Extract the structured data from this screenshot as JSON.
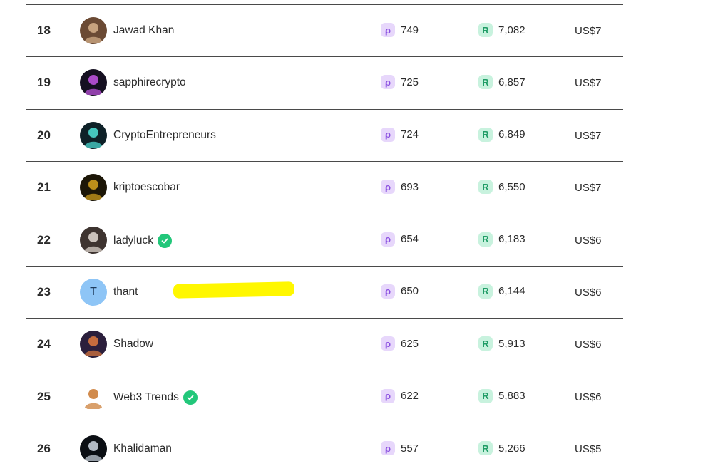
{
  "rows": [
    {
      "rank": "18",
      "name": "Jawad Khan",
      "verified": false,
      "points": "749",
      "reward": "7,082",
      "usd": "US$7",
      "avatar": {
        "kind": "photo",
        "bg": "#6b4a34",
        "fg": "#d7b28c"
      }
    },
    {
      "rank": "19",
      "name": "sapphirecrypto",
      "verified": false,
      "points": "725",
      "reward": "6,857",
      "usd": "US$7",
      "avatar": {
        "kind": "logo",
        "bg": "#151021",
        "fg": "#c456e6"
      }
    },
    {
      "rank": "20",
      "name": "CryptoEntrepreneurs",
      "verified": false,
      "points": "724",
      "reward": "6,849",
      "usd": "US$7",
      "avatar": {
        "kind": "logo",
        "bg": "#0e2128",
        "fg": "#4fe3d8"
      }
    },
    {
      "rank": "21",
      "name": "kriptoescobar",
      "verified": false,
      "points": "693",
      "reward": "6,550",
      "usd": "US$7",
      "avatar": {
        "kind": "photo",
        "bg": "#1c1607",
        "fg": "#d8a51d"
      }
    },
    {
      "rank": "22",
      "name": "ladyluck",
      "verified": true,
      "points": "654",
      "reward": "6,183",
      "usd": "US$6",
      "avatar": {
        "kind": "photo",
        "bg": "#3e3430",
        "fg": "#e4dcd3"
      }
    },
    {
      "rank": "23",
      "name": "thant",
      "verified": false,
      "points": "650",
      "reward": "6,144",
      "usd": "US$6",
      "avatar": {
        "kind": "letter",
        "letter": "T"
      }
    },
    {
      "rank": "24",
      "name": "Shadow",
      "verified": false,
      "points": "625",
      "reward": "5,913",
      "usd": "US$6",
      "avatar": {
        "kind": "photo",
        "bg": "#2b1f3c",
        "fg": "#e07a3e"
      }
    },
    {
      "rank": "25",
      "name": "Web3 Trends",
      "verified": true,
      "points": "622",
      "reward": "5,883",
      "usd": "US$6",
      "avatar": {
        "kind": "logo",
        "bg": "#ffffff",
        "fg": "#c9772e"
      }
    },
    {
      "rank": "26",
      "name": "Khalidaman",
      "verified": false,
      "points": "557",
      "reward": "5,266",
      "usd": "US$5",
      "avatar": {
        "kind": "logo",
        "bg": "#0b0f14",
        "fg": "#cfd8e3"
      }
    }
  ],
  "icons": {
    "points": "p-token-icon",
    "reward": "r-token-icon",
    "verified": "verified-check-icon"
  },
  "colors": {
    "points_accent": "#8a4fe0",
    "reward_accent": "#1f9c66",
    "verified": "#22c77a",
    "highlight": "#fff700"
  }
}
